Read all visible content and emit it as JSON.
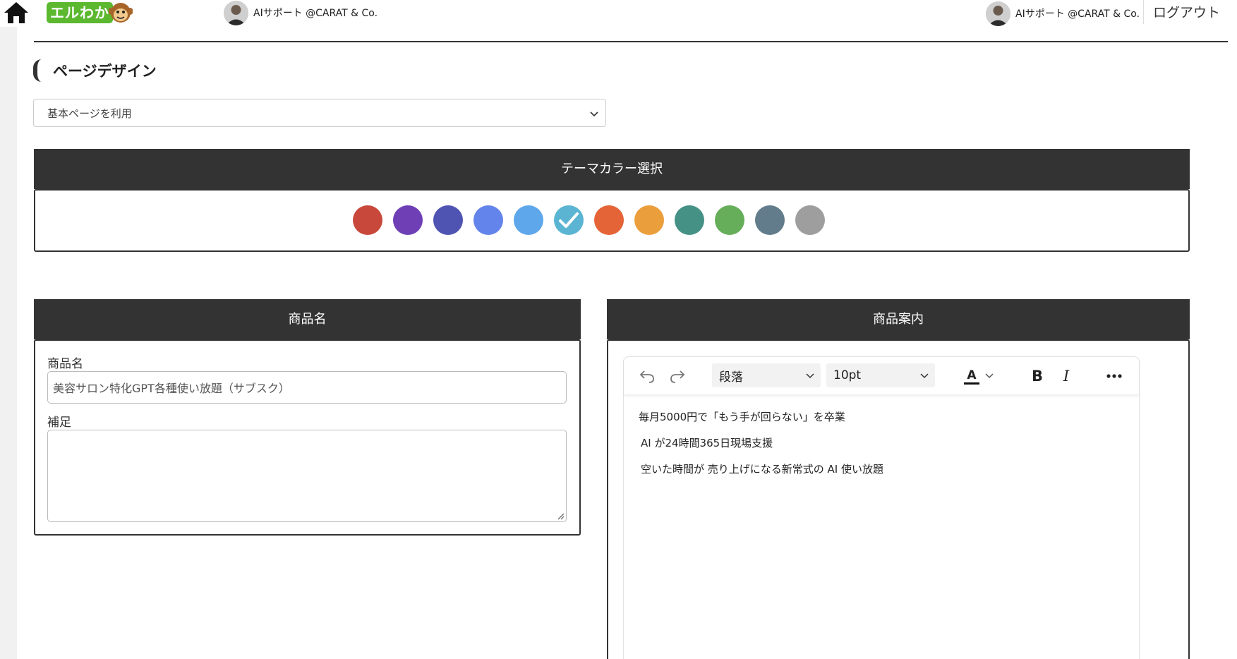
{
  "header": {
    "logo_text": "エルわか",
    "account_center": "AIサポート @CARAT & Co.",
    "account_right": "AIサポート @CARAT & Co.",
    "logout": "ログアウト"
  },
  "design": {
    "section_title": "ページデザイン",
    "page_select_value": "基本ページを利用",
    "theme_header": "テーマカラー選択",
    "colors": [
      "#c8493c",
      "#6f3fb6",
      "#4f53b1",
      "#6384ea",
      "#5ea7ea",
      "#5bb5d2",
      "#e46437",
      "#eb9e3c",
      "#459186",
      "#66ae59",
      "#637c8b",
      "#9e9e9e"
    ],
    "selected_color_index": 5
  },
  "product_name": {
    "header": "商品名",
    "name_label": "商品名",
    "name_value": "美容サロン特化GPT各種使い放題（サブスク）",
    "note_label": "補足",
    "note_value": ""
  },
  "product_info": {
    "header": "商品案内",
    "toolbar": {
      "block_format": "段落",
      "font_size": "10pt",
      "font_color_glyph": "A",
      "bold_glyph": "B",
      "italic_glyph": "I"
    },
    "content_lines": [
      "毎月5000円で「もう手が回らない」を卒業",
      "AI が24時間365日現場支援",
      "空いた時間が 売り上げになる新常式の AI 使い放題"
    ]
  }
}
